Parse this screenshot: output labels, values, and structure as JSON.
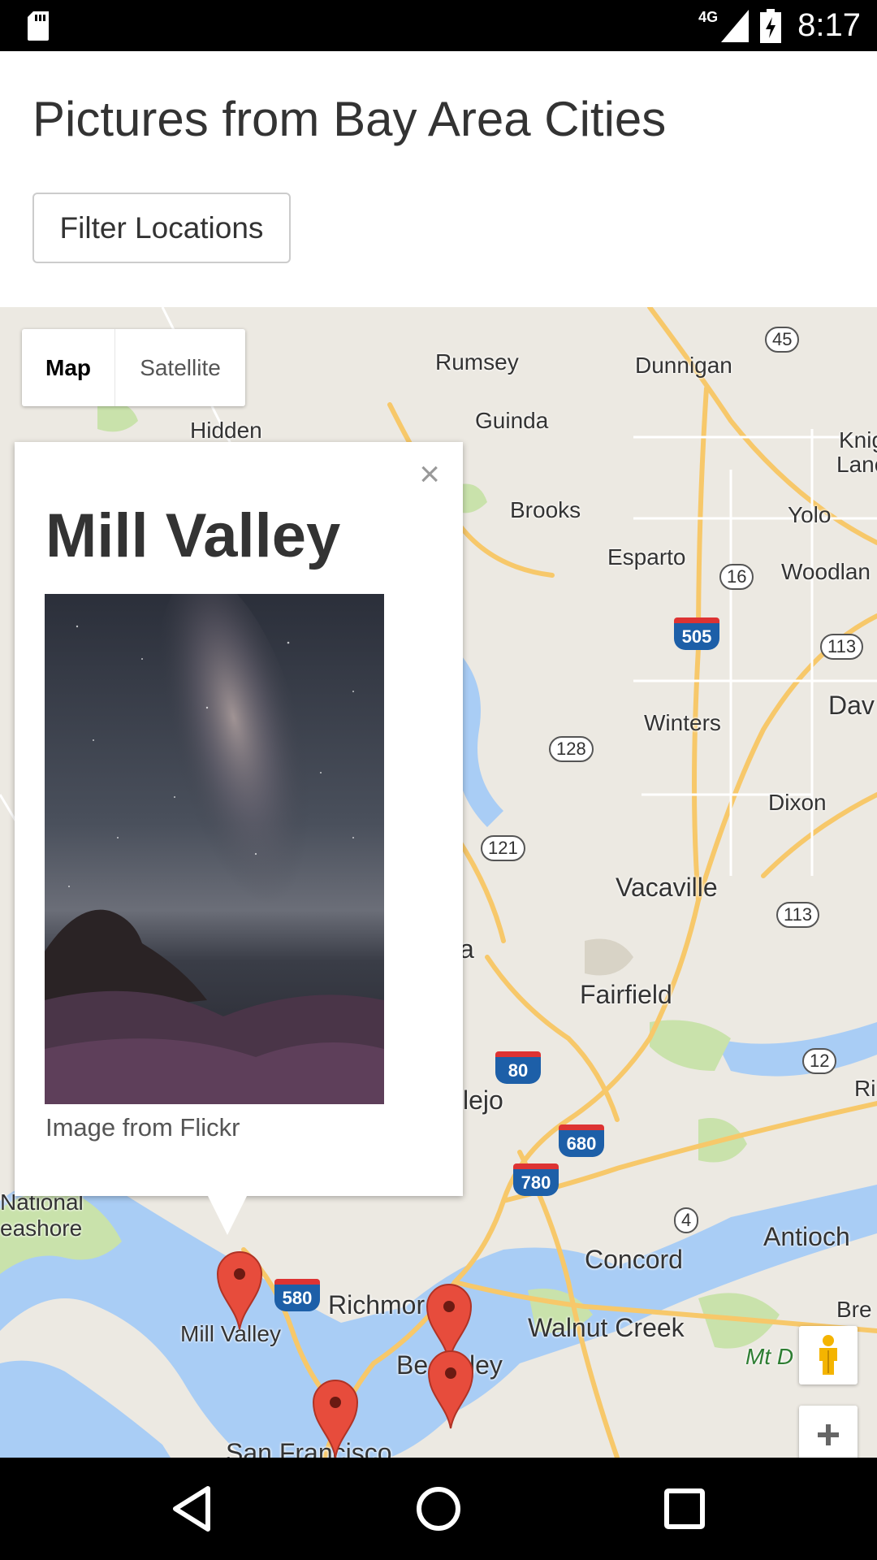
{
  "status_bar": {
    "network": "4G",
    "time": "8:17"
  },
  "header": {
    "title": "Pictures from Bay Area Cities",
    "filter_label": "Filter Locations"
  },
  "map": {
    "type_control": {
      "map_label": "Map",
      "satellite_label": "Satellite",
      "selected": "Map"
    },
    "place_labels": [
      "Rumsey",
      "Dunnigan",
      "Guinda",
      "Hidden",
      "Brooks",
      "Yolo",
      "Esparto",
      "Woodlan",
      "Knig",
      "Lane",
      "Winters",
      "Dav",
      "Dixon",
      "Vacaville",
      "Fairfield",
      "lejo",
      "Antioch",
      "Concord",
      "Walnut Creek",
      "Richmor",
      "Be",
      "ley",
      "Mill Valley",
      "National",
      "eashore",
      "Mt D",
      "Ri",
      "Bre",
      "a",
      "San Francisco"
    ],
    "highway_labels": [
      "45",
      "16",
      "113",
      "128",
      "121",
      "113",
      "12",
      "4"
    ],
    "interstate_labels": [
      "505",
      "80",
      "680",
      "780",
      "580"
    ],
    "info_window": {
      "title": "Mill Valley",
      "caption": "Image from Flickr",
      "close_symbol": "×"
    },
    "colors": {
      "water": "#a9cdf5",
      "land": "#ece9e2",
      "park": "#c9e2ab",
      "road": "#f7c86a",
      "marker": "#e74c3c"
    }
  }
}
